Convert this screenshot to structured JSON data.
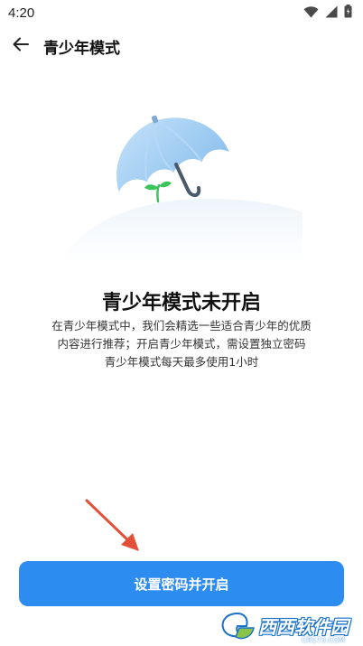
{
  "status_bar": {
    "time": "4:20",
    "icons": [
      "wifi-icon",
      "signal-icon",
      "battery-icon"
    ]
  },
  "app_bar": {
    "back_icon": "arrow-left-icon",
    "title": "青少年模式"
  },
  "illustration": {
    "subject": "umbrella-sprout",
    "umbrella_color": "#a9d3f5",
    "sprout_color": "#3cc35c"
  },
  "main": {
    "headline": "青少年模式未开启",
    "description_lines": [
      "在青少年模式中，我们会精选一些适合青少年的优质",
      "内容进行推荐；开启青少年模式，需设置独立密码",
      "青少年模式每天最多使用1小时"
    ]
  },
  "action": {
    "button_label": "设置密码并开启",
    "button_color": "#2d8cf0"
  },
  "annotation": {
    "arrow_color": "#e2503a"
  },
  "watermark": {
    "main_text": "西西软件园",
    "sub_text": "CR173.COM"
  }
}
